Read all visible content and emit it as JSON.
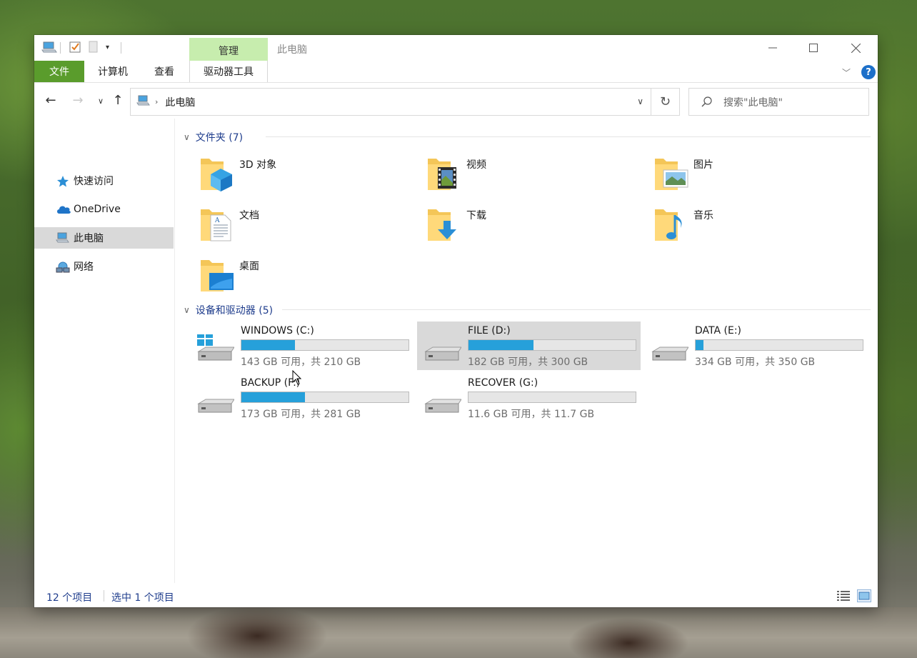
{
  "window": {
    "title": "此电脑",
    "contextual_tab_group": "管理"
  },
  "ribbon": {
    "tabs": [
      "文件",
      "计算机",
      "查看",
      "驱动器工具"
    ]
  },
  "address": {
    "path": "此电脑",
    "search_placeholder": "搜索\"此电脑\""
  },
  "sidebar": {
    "items": [
      {
        "label": "快速访问",
        "icon": "star-icon"
      },
      {
        "label": "OneDrive",
        "icon": "cloud-icon"
      },
      {
        "label": "此电脑",
        "icon": "computer-icon",
        "selected": true
      },
      {
        "label": "网络",
        "icon": "network-icon"
      }
    ]
  },
  "groups": {
    "folders_header": "文件夹 (7)",
    "drives_header": "设备和驱动器 (5)"
  },
  "folders": [
    {
      "name": "3D 对象",
      "icon": "3d-objects-folder-icon"
    },
    {
      "name": "视频",
      "icon": "videos-folder-icon"
    },
    {
      "name": "图片",
      "icon": "pictures-folder-icon"
    },
    {
      "name": "文档",
      "icon": "documents-folder-icon"
    },
    {
      "name": "下载",
      "icon": "downloads-folder-icon"
    },
    {
      "name": "音乐",
      "icon": "music-folder-icon"
    },
    {
      "name": "桌面",
      "icon": "desktop-folder-icon"
    }
  ],
  "drives": [
    {
      "name": "WINDOWS (C:)",
      "info": "143 GB 可用，共 210 GB",
      "used_fraction": 0.32,
      "system": true
    },
    {
      "name": "FILE (D:)",
      "info": "182 GB 可用，共 300 GB",
      "used_fraction": 0.39,
      "selected": true
    },
    {
      "name": "DATA (E:)",
      "info": "334 GB 可用，共 350 GB",
      "used_fraction": 0.045
    },
    {
      "name": "BACKUP (F:)",
      "info": "173 GB 可用，共 281 GB",
      "used_fraction": 0.38
    },
    {
      "name": "RECOVER (G:)",
      "info": "11.6 GB 可用，共 11.7 GB",
      "used_fraction": 0.0
    }
  ],
  "status": {
    "item_count": "12 个项目",
    "selected_count": "选中 1 个项目"
  },
  "colors": {
    "file_tab": "#5a9c2c",
    "manage_tab": "#c7edae",
    "usage_bar": "#26a0da",
    "selection": "#d9d9d9",
    "link_text": "#1e3c8c"
  }
}
